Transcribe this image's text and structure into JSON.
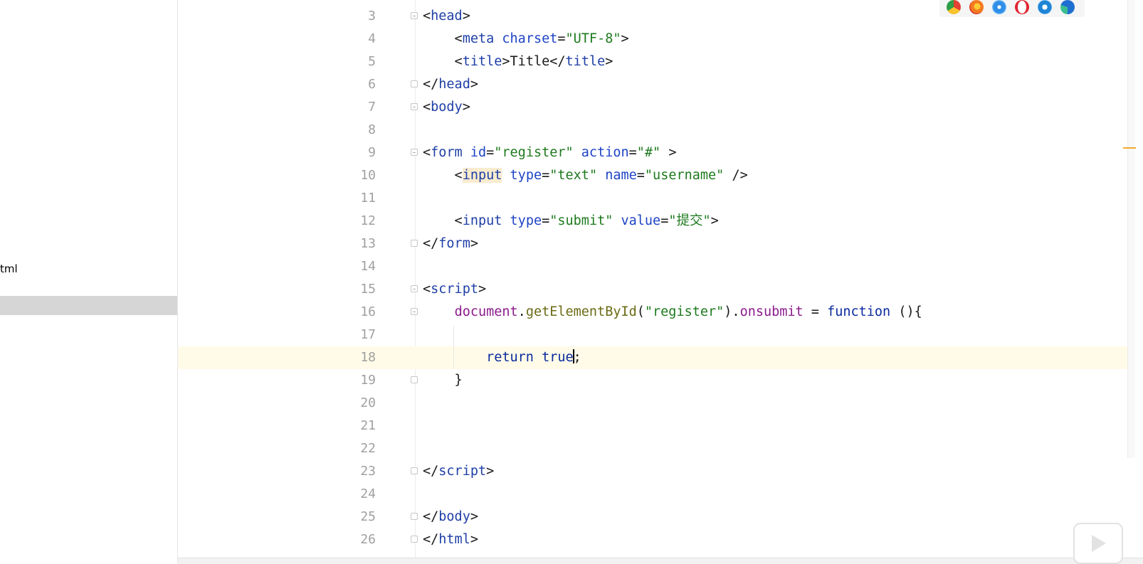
{
  "sidebar": {
    "file_label": "tml"
  },
  "editor": {
    "lines": [
      {
        "n": "3"
      },
      {
        "n": "4"
      },
      {
        "n": "5"
      },
      {
        "n": "6"
      },
      {
        "n": "7"
      },
      {
        "n": "8"
      },
      {
        "n": "9"
      },
      {
        "n": "10"
      },
      {
        "n": "11"
      },
      {
        "n": "12"
      },
      {
        "n": "13"
      },
      {
        "n": "14"
      },
      {
        "n": "15"
      },
      {
        "n": "16"
      },
      {
        "n": "17"
      },
      {
        "n": "18"
      },
      {
        "n": "19"
      },
      {
        "n": "20"
      },
      {
        "n": "21"
      },
      {
        "n": "22"
      },
      {
        "n": "23"
      },
      {
        "n": "24"
      },
      {
        "n": "25"
      },
      {
        "n": "26"
      }
    ],
    "code": {
      "head_open": "head",
      "meta_tag": "meta",
      "meta_attr": "charset",
      "meta_val": "\"UTF-8\"",
      "title_tag": "title",
      "title_text": "Title",
      "head_close": "head",
      "body_open": "body",
      "form_tag": "form",
      "form_id_attr": "id",
      "form_id_val": "\"register\"",
      "form_action_attr": "action",
      "form_action_val": "\"#\"",
      "input_tag": "input",
      "type_attr": "type",
      "type_text_val": "\"text\"",
      "name_attr": "name",
      "name_val": "\"username\"",
      "type_submit_val": "\"submit\"",
      "value_attr": "value",
      "value_val": "\"提交\"",
      "form_close": "form",
      "script_open": "script",
      "doc_obj": "document",
      "get_method": "getElementById",
      "register_arg": "\"register\"",
      "onsubmit_prop": "onsubmit",
      "function_kw": "function",
      "return_kw": "return",
      "true_kw": "true",
      "script_close": "script",
      "body_close": "body",
      "html_close": "html"
    },
    "current_line": "18"
  },
  "browser_icons": [
    "chrome-icon",
    "firefox-icon",
    "safari-icon",
    "opera-icon",
    "ie-icon",
    "edge-icon"
  ],
  "colors": {
    "tag": "#1f3fa6",
    "string": "#1e7a1e",
    "property": "#8b1b8b",
    "current_line": "#fffbe8"
  }
}
